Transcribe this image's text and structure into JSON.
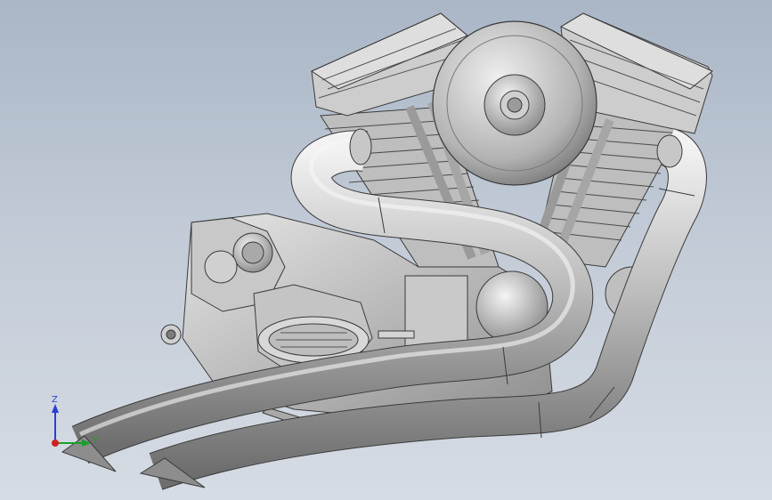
{
  "viewport": {
    "background_top": "#aab6c6",
    "background_bottom": "#d6dce4"
  },
  "model": {
    "part_color": "#b9b9b9",
    "edge_color": "#3a3a3a"
  },
  "triad": {
    "z_label": "Z",
    "y_label": "Y",
    "z_color": "#2a3fd0",
    "y_color": "#1aa02a",
    "x_color": "#d02020"
  }
}
